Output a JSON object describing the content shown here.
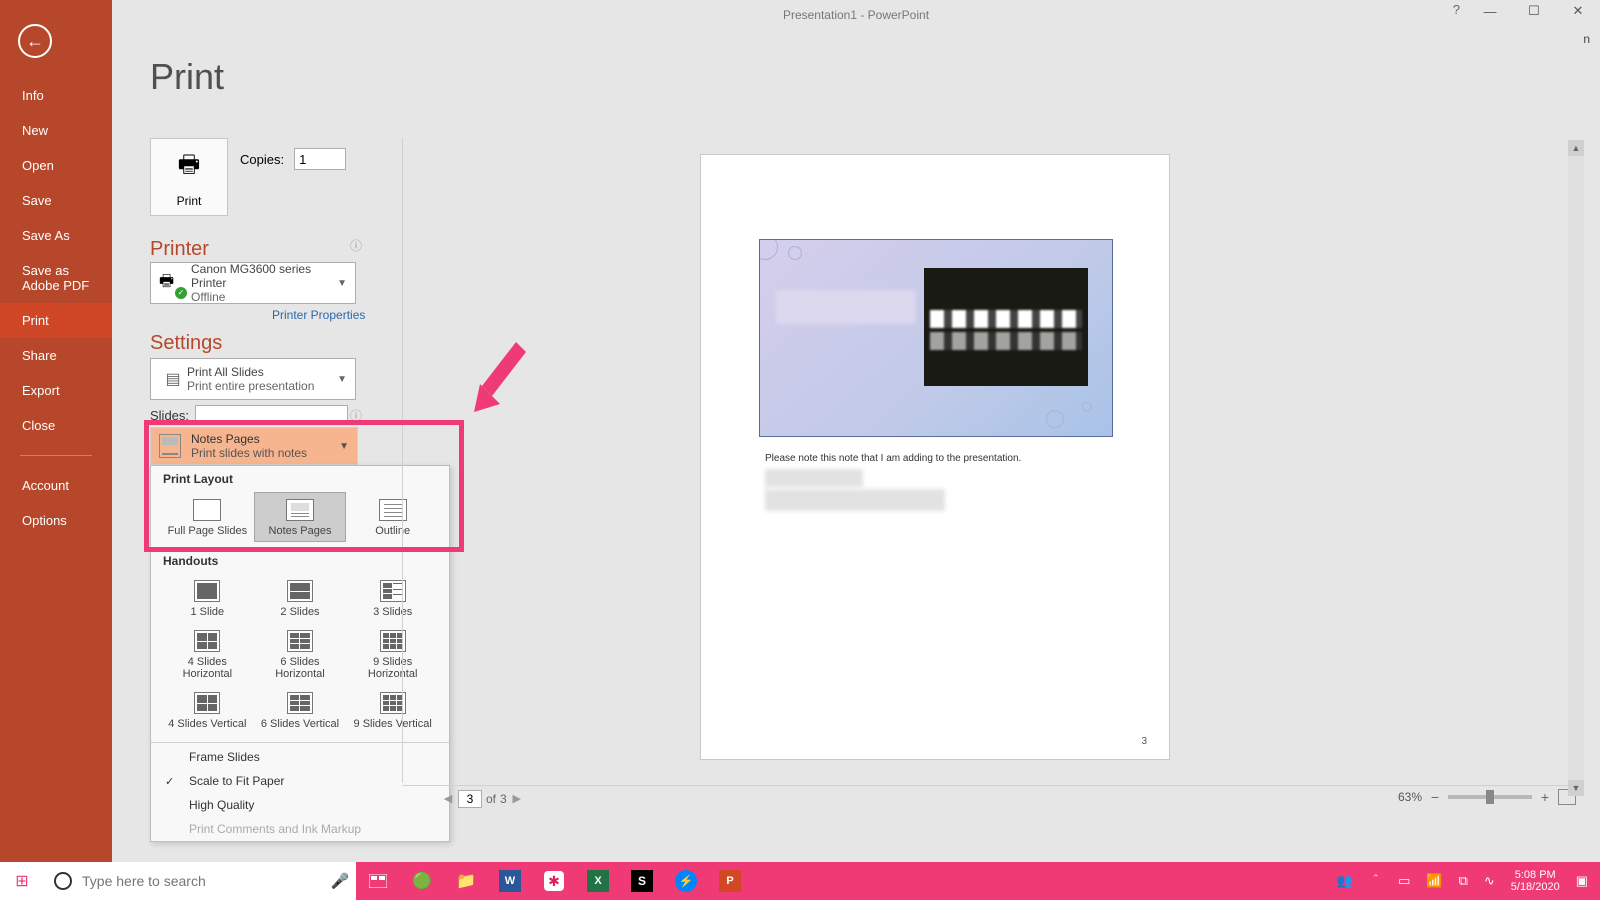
{
  "title_bar": {
    "title": "Presentation1 - PowerPoint",
    "sign_in": "Sign in"
  },
  "sidebar": {
    "items": [
      "Info",
      "New",
      "Open",
      "Save",
      "Save As",
      "Save as Adobe PDF",
      "Print",
      "Share",
      "Export",
      "Close"
    ],
    "footer": [
      "Account",
      "Options"
    ],
    "selected_index": 6
  },
  "page": {
    "title": "Print"
  },
  "print_button": {
    "label": "Print"
  },
  "copies": {
    "label": "Copies:",
    "value": "1"
  },
  "printer": {
    "heading": "Printer",
    "name": "Canon MG3600 series Printer",
    "status": "Offline",
    "properties_link": "Printer Properties"
  },
  "settings": {
    "heading": "Settings",
    "print_what": {
      "title": "Print All Slides",
      "sub": "Print entire presentation"
    },
    "slides_label": "Slides:",
    "slides_value": "",
    "layout_selector": {
      "title": "Notes Pages",
      "sub": "Print slides with notes"
    }
  },
  "layout_dropdown": {
    "print_layout_label": "Print Layout",
    "layouts": [
      "Full Page Slides",
      "Notes Pages",
      "Outline"
    ],
    "selected_layout_index": 1,
    "handouts_label": "Handouts",
    "handouts": [
      "1 Slide",
      "2 Slides",
      "3 Slides",
      "4 Slides Horizontal",
      "6 Slides Horizontal",
      "9 Slides Horizontal",
      "4 Slides Vertical",
      "6 Slides Vertical",
      "9 Slides Vertical"
    ],
    "options": [
      {
        "label": "Frame Slides",
        "checked": false,
        "disabled": false
      },
      {
        "label": "Scale to Fit Paper",
        "checked": true,
        "disabled": false
      },
      {
        "label": "High Quality",
        "checked": false,
        "disabled": false
      },
      {
        "label": "Print Comments and Ink Markup",
        "checked": false,
        "disabled": true
      }
    ]
  },
  "preview": {
    "note_text": "Please note this note that I am adding to the presentation.",
    "page_number_shown": "3",
    "nav": {
      "current": "3",
      "total": "3"
    },
    "zoom_pct": "63%"
  },
  "taskbar": {
    "search_placeholder": "Type here to search",
    "time": "5:08 PM",
    "date": "5/18/2020"
  }
}
